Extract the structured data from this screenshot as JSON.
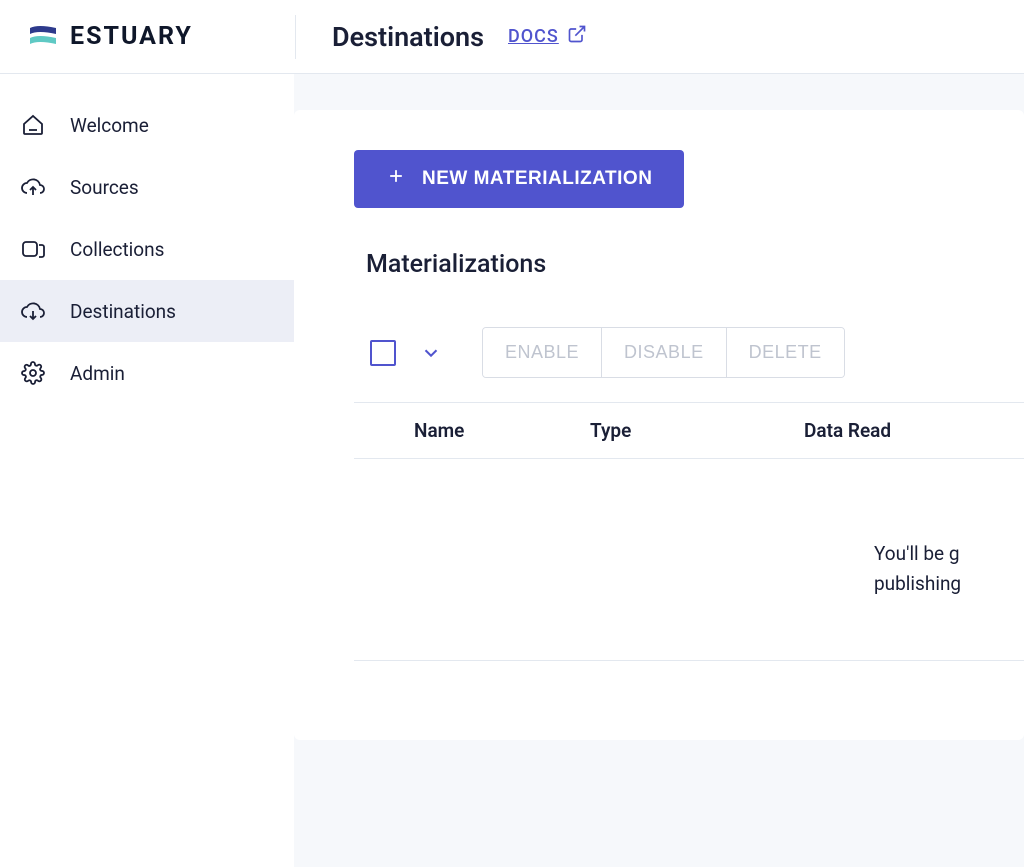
{
  "brand": {
    "name": "ESTUARY"
  },
  "header": {
    "title": "Destinations",
    "docs_label": "DOCS"
  },
  "sidebar": {
    "items": [
      {
        "label": "Welcome"
      },
      {
        "label": "Sources"
      },
      {
        "label": "Collections"
      },
      {
        "label": "Destinations"
      },
      {
        "label": "Admin"
      }
    ]
  },
  "main": {
    "new_button_label": "NEW MATERIALIZATION",
    "section_heading": "Materializations",
    "toolbar": {
      "enable": "ENABLE",
      "disable": "DISABLE",
      "delete": "DELETE"
    },
    "columns": {
      "name": "Name",
      "type": "Type",
      "data_read": "Data Read"
    },
    "empty_state": {
      "line1": "You'll be g",
      "line2": "publishing"
    }
  }
}
